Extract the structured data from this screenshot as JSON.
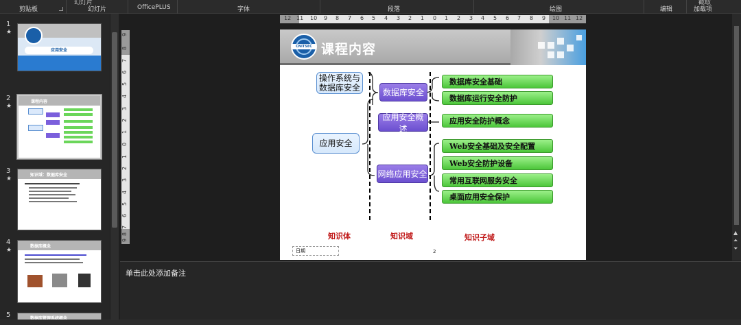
{
  "ribbon": {
    "groups": [
      "剪贴板",
      "幻灯片",
      "OfficePLUS",
      "字体",
      "段落",
      "绘图",
      "编辑",
      "加载项"
    ],
    "clipped_labels": [
      "幻灯片",
      "截取"
    ]
  },
  "thumbnails": [
    {
      "num": "1",
      "star": "★",
      "title": "应用安全"
    },
    {
      "num": "2",
      "star": "★",
      "title": "课程内容"
    },
    {
      "num": "3",
      "star": "★",
      "title": "知识域：数据库安全"
    },
    {
      "num": "4",
      "star": "★",
      "title": "数据库概念"
    },
    {
      "num": "5",
      "star": "",
      "title": "数据库管理系统概念"
    }
  ],
  "ruler": {
    "horizontal": [
      "12",
      "11",
      "10",
      "9",
      "8",
      "7",
      "6",
      "5",
      "4",
      "3",
      "2",
      "1",
      "0",
      "1",
      "2",
      "3",
      "4",
      "5",
      "6",
      "7",
      "8",
      "9",
      "10",
      "11",
      "12"
    ],
    "vertical": [
      "9",
      "8",
      "7",
      "6",
      "5",
      "4",
      "3",
      "2",
      "1",
      "0",
      "1",
      "2",
      "3",
      "4",
      "5",
      "6",
      "7",
      "8",
      "9"
    ]
  },
  "slide": {
    "title": "课程内容",
    "knowledge_body": [
      "操作系统与数据库安全",
      "应用安全"
    ],
    "knowledge_domains": [
      "数据库安全",
      "应用安全概述",
      "网络应用安全"
    ],
    "knowledge_subdomains": [
      "数据库安全基础",
      "数据库运行安全防护",
      "应用安全防护概念",
      "Web安全基础及安全配置",
      "Web安全防护设备",
      "常用互联网服务安全",
      "桌面应用安全保护"
    ],
    "column_labels": [
      "知识体",
      "知识域",
      "知识子域"
    ],
    "date_placeholder": "日期",
    "page_number": "2"
  },
  "notes": {
    "placeholder": "单击此处添加备注"
  },
  "colors": {
    "purple": "#6b4fd0",
    "green": "#4cc63a",
    "label_red": "#c01818"
  }
}
